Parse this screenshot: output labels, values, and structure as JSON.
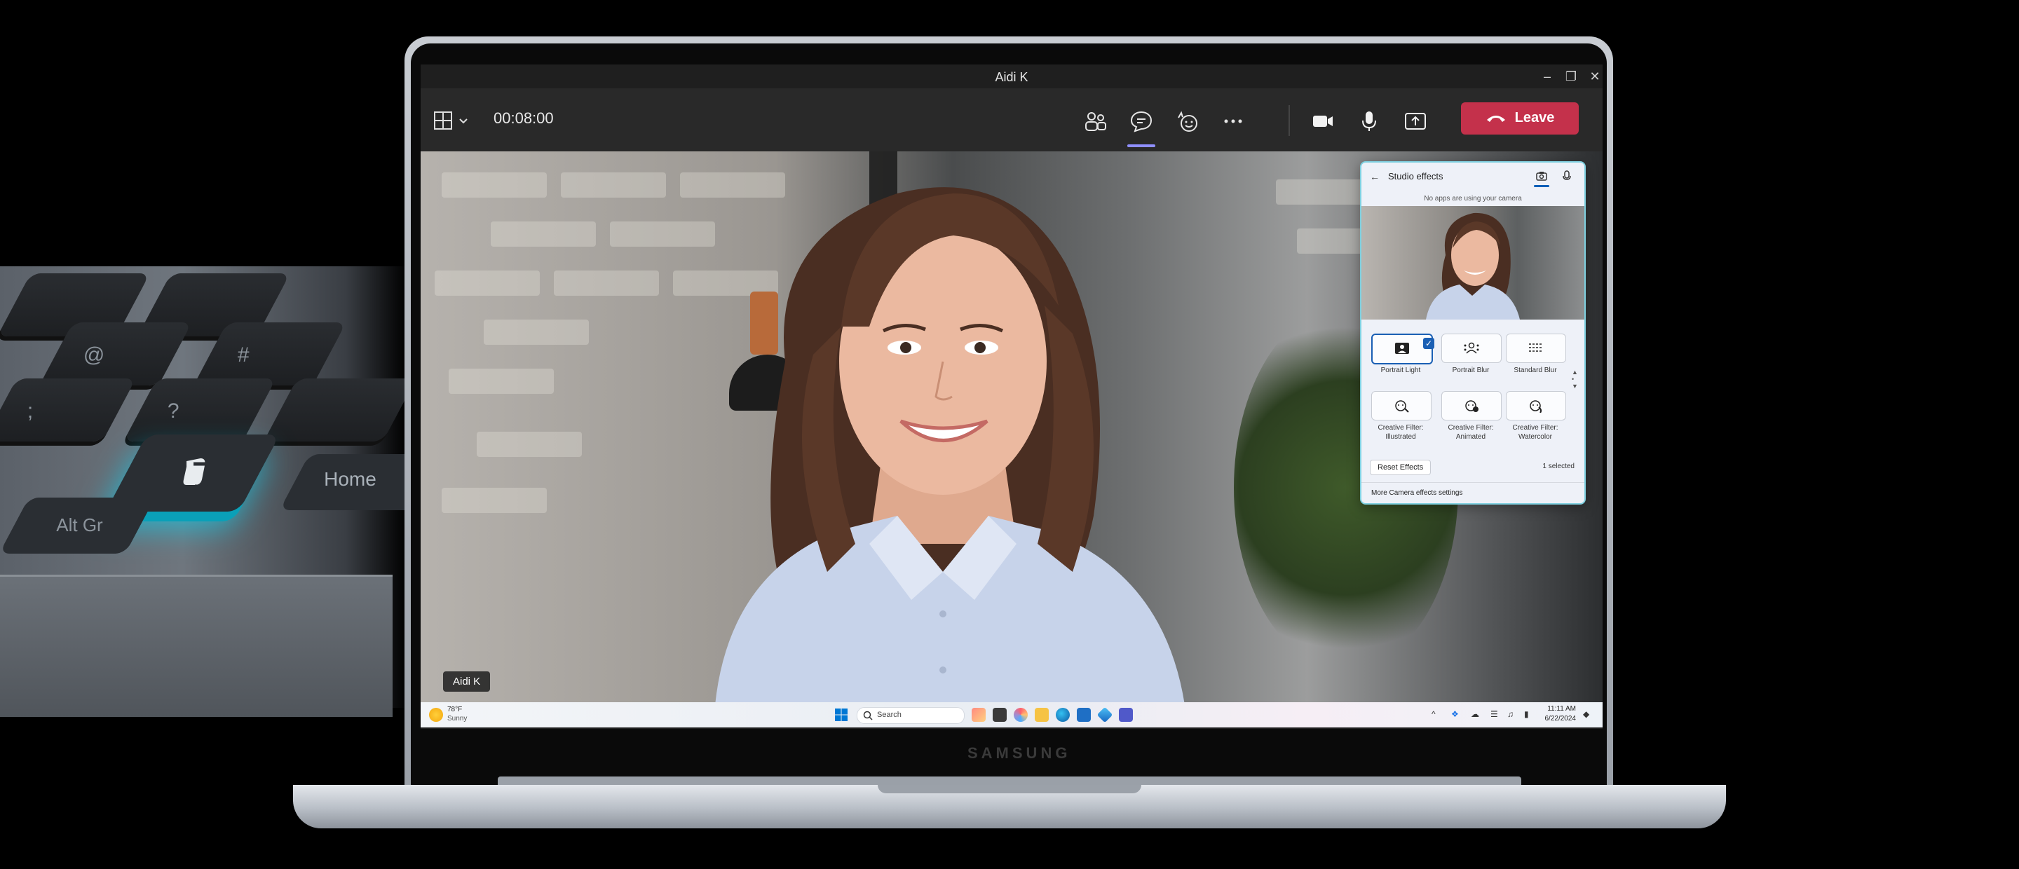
{
  "window": {
    "title": "Aidi K"
  },
  "toolbar": {
    "timer": "00:08:00",
    "leave_label": "Leave"
  },
  "video": {
    "participant_name": "Aidi K"
  },
  "studio_effects": {
    "title": "Studio effects",
    "status": "No apps are using your camera",
    "effects": [
      {
        "label": "Portrait Light",
        "selected": true
      },
      {
        "label": "Portrait Blur",
        "selected": false
      },
      {
        "label": "Standard Blur",
        "selected": false
      },
      {
        "label_line1": "Creative Filter:",
        "label_line2": "Illustrated",
        "selected": false
      },
      {
        "label_line1": "Creative Filter:",
        "label_line2": "Animated",
        "selected": false
      },
      {
        "label_line1": "Creative Filter:",
        "label_line2": "Watercolor",
        "selected": false
      }
    ],
    "reset_label": "Reset Effects",
    "selected_count": "1 selected",
    "footer_link": "More Camera effects settings"
  },
  "taskbar": {
    "weather_temp": "78°F",
    "weather_condition": "Sunny",
    "search_label": "Search",
    "time": "11:11 AM",
    "date": "6/22/2024"
  },
  "keyboard": {
    "home_key": "Home",
    "altgr_key": "Alt Gr"
  },
  "device": {
    "brand": "SAMSUNG"
  },
  "colors": {
    "leave_red": "#c4314b",
    "accent_purple": "#8f8fff",
    "copilot_glow": "#0aa0b8"
  }
}
